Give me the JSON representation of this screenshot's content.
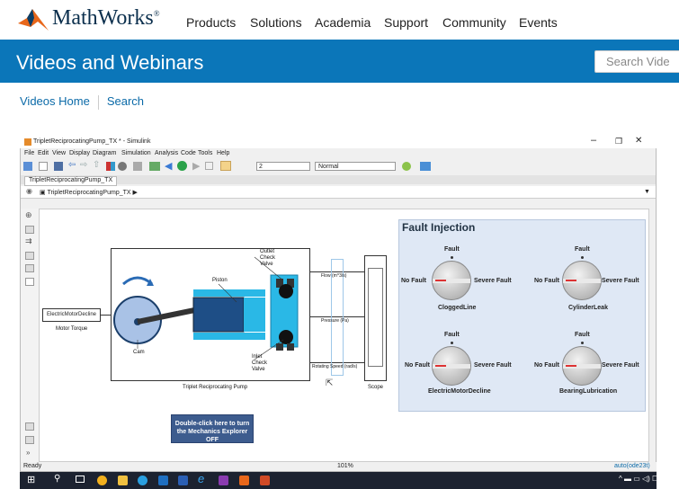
{
  "site": {
    "brand": "MathWorks",
    "brand_mark": "®",
    "nav": [
      "Products",
      "Solutions",
      "Academia",
      "Support",
      "Community",
      "Events"
    ],
    "band_title": "Videos and Webinars",
    "search_placeholder": "Search Vide",
    "breadcrumbs": [
      "Videos Home",
      "Search"
    ]
  },
  "simulink": {
    "title": "TripletReciprocatingPump_TX * - Simulink",
    "menu": [
      "File",
      "Edit",
      "View",
      "Display",
      "Diagram",
      "Simulation",
      "Analysis",
      "Code",
      "Tools",
      "Help"
    ],
    "stop_time": "2",
    "sim_mode": "Normal",
    "tab": "TripletReciprocatingPump_TX",
    "model_path": "TripletReciprocatingPump_TX",
    "status_left": "Ready",
    "status_zoom": "101%",
    "status_right": "auto(ode23t)"
  },
  "diagram": {
    "source_block": "ElectricMotorDecline",
    "source_label": "Motor Torque",
    "pump_label": "Triplet Reciprocating Pump",
    "parts": {
      "outlet": "Outlet\nCheck\nValve",
      "piston": "Piston",
      "cam": "Cam",
      "inlet": "Inlet\nCheck\nValve"
    },
    "signals": [
      "Flow (m^3/s)",
      "Pressure (Pa)",
      "Rotating Speed (rad/s)"
    ],
    "scope_label": "Scope",
    "mech_button": "Double-click here to turn the Mechanics Explorer OFF"
  },
  "fault": {
    "title": "Fault Injection",
    "knobs": [
      {
        "name": "CloggedLine",
        "top": "Fault",
        "left": "No Fault",
        "right": "Severe Fault"
      },
      {
        "name": "CylinderLeak",
        "top": "Fault",
        "left": "No Fault",
        "right": "Severe Fault"
      },
      {
        "name": "ElectricMotorDecline",
        "top": "Fault",
        "left": "No Fault",
        "right": "Severe Fault"
      },
      {
        "name": "BearingLubrication",
        "top": "Fault",
        "left": "No Fault",
        "right": "Severe Fault"
      }
    ]
  },
  "colors": {
    "brand_blue": "#0b76b9",
    "pump_cyan": "#2ab8e6",
    "piston_navy": "#1e4e86",
    "button_blue": "#3d5c8e"
  }
}
